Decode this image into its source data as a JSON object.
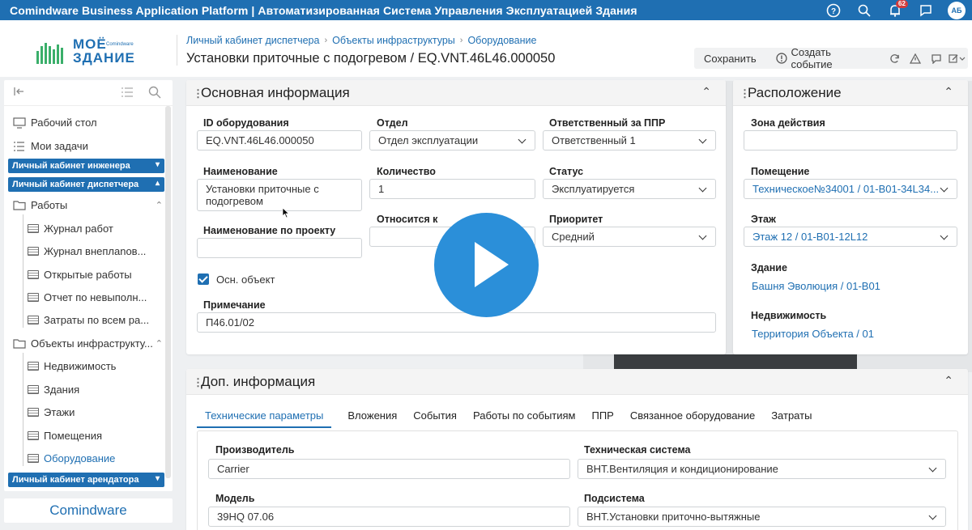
{
  "app": {
    "title": "Comindware Business Application Platform | Автоматизированная Система Управления Эксплуатацией Здания",
    "notifications_count": "62",
    "user_initials": "АБ"
  },
  "brand": {
    "logo_line1": "МОЁ",
    "logo_line2": "ЗДАНИЕ",
    "logo_small": "Comindware",
    "footer_logo": "Comindware"
  },
  "breadcrumb": [
    "Личный кабинет диспетчера",
    "Объекты инфраструктуры",
    "Оборудование"
  ],
  "page_title": "Установки приточные с подогревом / EQ.VNT.46L46.000050",
  "actions": {
    "save": "Сохранить",
    "create_event": "Создать событие"
  },
  "sidebar": {
    "desktop": "Рабочий стол",
    "tasks": "Мои задачи",
    "group_engineer": "Личный кабинет инженера",
    "group_dispatcher": "Личный кабинет диспетчера",
    "works": "Работы",
    "works_items": [
      "Журнал работ",
      "Журнал внеплanов...",
      "Открытые работы",
      "Отчет по невыполн...",
      "Затраты по всем ра..."
    ],
    "infra": "Объекты инфраструкту...",
    "infra_items": [
      "Недвижимость",
      "Здания",
      "Этажи",
      "Помещения",
      "Оборудование"
    ],
    "group_tenant": "Личный кабинет арендатора"
  },
  "main_info": {
    "title": "Основная информация",
    "equipment_id_label": "ID оборудования",
    "equipment_id": "EQ.VNT.46L46.000050",
    "department_label": "Отдел",
    "department": "Отдел эксплуатации",
    "responsible_label": "Ответственный за ППР",
    "responsible": "Ответственный 1",
    "name_label": "Наименование",
    "name": "Установки приточные с подогревом",
    "quantity_label": "Количество",
    "quantity": "1",
    "status_label": "Статус",
    "status": "Эксплуатируется",
    "project_name_label": "Наименование по проекту",
    "project_name": "",
    "relates_label": "Относится к",
    "relates": "",
    "priority_label": "Приоритет",
    "priority": "Средний",
    "main_object_label": "Осн. объект",
    "note_label": "Примечание",
    "note": "П46.01/02"
  },
  "location": {
    "title": "Расположение",
    "zone_label": "Зона действия",
    "zone": "",
    "room_label": "Помещение",
    "room": "Техническое№34001 / 01-B01-34L34...",
    "floor_label": "Этаж",
    "floor": "Этаж 12 / 01-B01-12L12",
    "building_label": "Здание",
    "building": "Башня Эволюция / 01-B01",
    "property_label": "Недвижимость",
    "property": "Территория Объекта / 01"
  },
  "extra": {
    "title": "Доп. информация",
    "tabs": [
      "Технические параметры",
      "Вложения",
      "События",
      "Работы по событиям",
      "ППР",
      "Связанное оборудование",
      "Затраты"
    ],
    "manufacturer_label": "Производитель",
    "manufacturer": "Carrier",
    "tech_system_label": "Техническая система",
    "tech_system": "ВНТ.Вентиляция и кондиционирование",
    "model_label": "Модель",
    "model": "39HQ 07.06",
    "subsystem_label": "Подсистема",
    "subsystem": "ВНТ.Установки приточно-вытяжные"
  }
}
